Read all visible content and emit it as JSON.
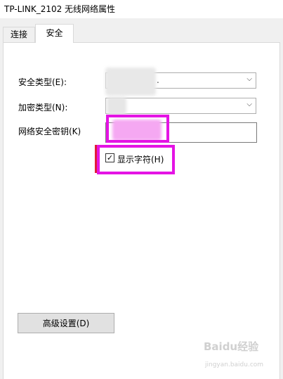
{
  "window": {
    "title": "TP-LINK_2102 无线网络属性"
  },
  "tabs": [
    {
      "label": "连接",
      "active": false
    },
    {
      "label": "安全",
      "active": true
    }
  ],
  "security": {
    "type_label": "安全类型(E):",
    "type_value": ".",
    "encryption_label": "加密类型(N):",
    "key_label": "网络安全密钥(K)",
    "show_chars_label": "显示字符(H)",
    "show_chars_checked": true,
    "show_chars_mark": "✓"
  },
  "advanced_button": {
    "label": "高级设置(D)"
  },
  "watermark": {
    "text": "Baidu经验",
    "sub": "jingyan.baidu.com"
  },
  "colors": {
    "highlight": "#e414e4",
    "redacted": "#f5a8f2",
    "accent_bar": "#e01c3b"
  }
}
